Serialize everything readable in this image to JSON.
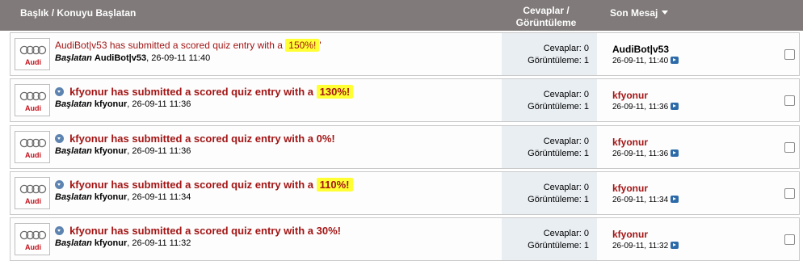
{
  "header": {
    "title_col": "Başlık / Konuyu Başlatan",
    "replies_col_line1": "Cevaplar /",
    "replies_col_line2": "Görüntüleme",
    "last_col": "Son Mesaj"
  },
  "threads": [
    {
      "title_prefix": "AudiBot|v53 has submitted a scored quiz entry with a ",
      "title_highlight": "150%!",
      "title_suffix": "'",
      "bold": false,
      "has_arrow": false,
      "starter_label": "Başlatan",
      "starter_name": "AudiBot|v53",
      "starter_date": ", 26-09-11 11:40",
      "replies_text": "Cevaplar: 0",
      "views_text": "Görüntüleme: 1",
      "last_user": "AudiBot|v53",
      "last_user_black": true,
      "last_date": "26-09-11, 11:40"
    },
    {
      "title_prefix": "kfyonur has submitted a scored quiz entry with a ",
      "title_highlight": "130%!",
      "title_suffix": "",
      "bold": true,
      "has_arrow": true,
      "starter_label": "Başlatan",
      "starter_name": "kfyonur",
      "starter_date": ", 26-09-11 11:36",
      "replies_text": "Cevaplar: 0",
      "views_text": "Görüntüleme: 1",
      "last_user": "kfyonur",
      "last_user_black": false,
      "last_date": "26-09-11, 11:36"
    },
    {
      "title_prefix": "kfyonur has submitted a scored quiz entry with a 0%!",
      "title_highlight": "",
      "title_suffix": "",
      "bold": true,
      "has_arrow": true,
      "starter_label": "Başlatan",
      "starter_name": "kfyonur",
      "starter_date": ", 26-09-11 11:36",
      "replies_text": "Cevaplar: 0",
      "views_text": "Görüntüleme: 1",
      "last_user": "kfyonur",
      "last_user_black": false,
      "last_date": "26-09-11, 11:36"
    },
    {
      "title_prefix": "kfyonur has submitted a scored quiz entry with a ",
      "title_highlight": "110%!",
      "title_suffix": "",
      "bold": true,
      "has_arrow": true,
      "starter_label": "Başlatan",
      "starter_name": "kfyonur",
      "starter_date": ", 26-09-11 11:34",
      "replies_text": "Cevaplar: 0",
      "views_text": "Görüntüleme: 1",
      "last_user": "kfyonur",
      "last_user_black": false,
      "last_date": "26-09-11, 11:34"
    },
    {
      "title_prefix": "kfyonur has submitted a scored quiz entry with a 30%!",
      "title_highlight": "",
      "title_suffix": "",
      "bold": true,
      "has_arrow": true,
      "starter_label": "Başlatan",
      "starter_name": "kfyonur",
      "starter_date": ", 26-09-11 11:32",
      "replies_text": "Cevaplar: 0",
      "views_text": "Görüntüleme: 1",
      "last_user": "kfyonur",
      "last_user_black": false,
      "last_date": "26-09-11, 11:32"
    }
  ],
  "logo": {
    "brand_word": "Audi"
  },
  "colors": {
    "header_bg": "#807a7a",
    "title_red": "#a31515",
    "highlight": "#ffff33"
  }
}
